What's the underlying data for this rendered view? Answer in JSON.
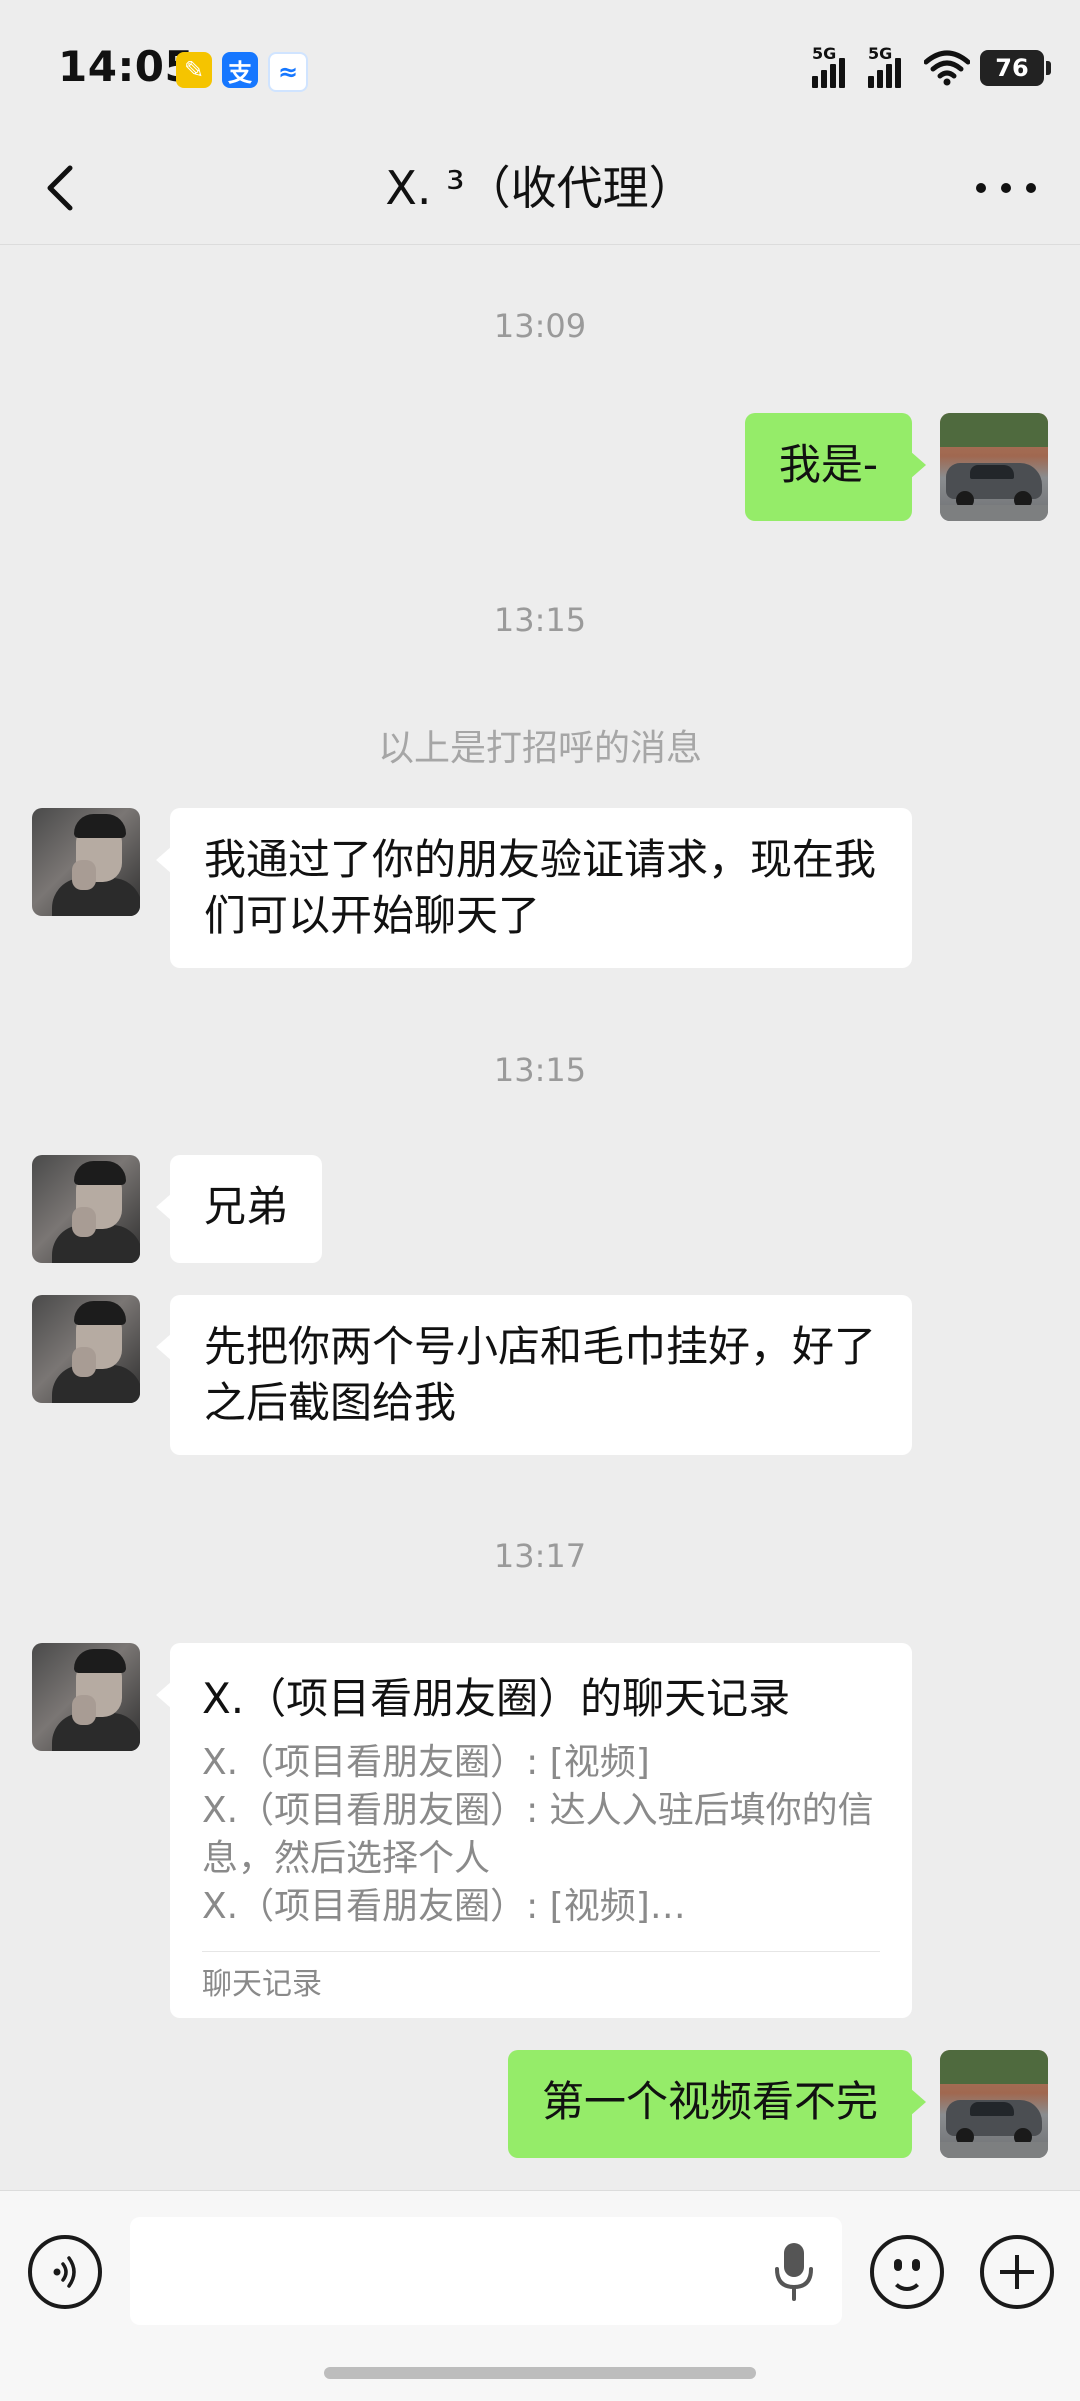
{
  "status_bar": {
    "time": "14:05",
    "app_icons": [
      {
        "icon": "notes-app-icon",
        "glyph": "✎"
      },
      {
        "icon": "alipay-icon",
        "glyph": "支"
      },
      {
        "icon": "fish-app-icon",
        "glyph": "≈"
      }
    ],
    "signal_1_tag": "5G",
    "signal_2_tag": "5G",
    "battery_level": "76"
  },
  "header": {
    "title": "X. ³（收代理）"
  },
  "messages": {
    "ts1": "13:09",
    "msg1": "我是-",
    "ts2": "13:15",
    "system": "以上是打招呼的消息",
    "msg2": "我通过了你的朋友验证请求，现在我们可以开始聊天了",
    "ts3": "13:15",
    "msg3": "兄弟",
    "msg4": "先把你两个号小店和毛巾挂好，好了之后截图给我",
    "ts4": "13:17",
    "record": {
      "title": "X.（项目看朋友圈）的聊天记录",
      "lines": [
        "X.（项目看朋友圈）: [视频]",
        "X.（项目看朋友圈）: 达人入驻后填你的信息，然后选择个人",
        "X.（项目看朋友圈）: [视频]…"
      ],
      "footer": "聊天记录"
    },
    "msg5": "第一个视频看不完"
  },
  "input_bar": {
    "placeholder": ""
  },
  "colors": {
    "background": "#ededed",
    "my_bubble": "#95ec69",
    "other_bubble": "#ffffff"
  }
}
